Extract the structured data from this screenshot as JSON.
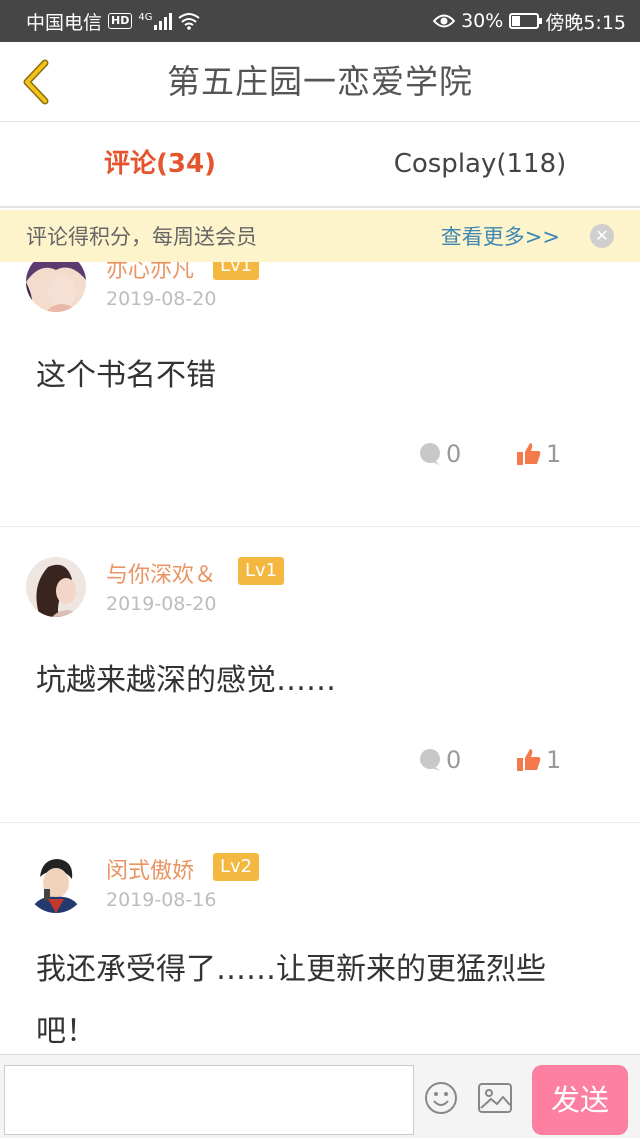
{
  "status_bar": {
    "carrier": "中国电信",
    "hd": "HD",
    "network": "4G",
    "battery_percent": "30%",
    "battery_level": 0.3,
    "time": "傍晚5:15"
  },
  "header": {
    "title": "第五庄园一恋爱学院"
  },
  "tabs": [
    {
      "label": "评论(34)",
      "active": true
    },
    {
      "label": "Cosplay(118)",
      "active": false
    }
  ],
  "banner": {
    "text": "评论得积分，每周送会员",
    "link": "查看更多>>",
    "close_icon": "close-icon"
  },
  "comments": [
    {
      "username": "亦心亦凡",
      "level": "Lv1",
      "date": "2019-08-20",
      "text": "这个书名不错",
      "reply_count": "0",
      "like_count": "1"
    },
    {
      "username": "与你深欢＆",
      "level": "Lv1",
      "date": "2019-08-20",
      "text": "坑越来越深的感觉……",
      "reply_count": "0",
      "like_count": "1"
    },
    {
      "username": "闵式傲娇",
      "level": "Lv2",
      "date": "2019-08-16",
      "text": "我还承受得了……让更新来的更猛烈些吧！",
      "reply_count": "",
      "like_count": ""
    }
  ],
  "bottom_bar": {
    "input_placeholder": "",
    "send_label": "发送"
  },
  "colors": {
    "accent": "#e4542d",
    "username": "#e99463",
    "level_badge": "#f4b840",
    "banner_bg": "#fdf4cc",
    "banner_link": "#3f86b2",
    "send_button": "#fd7fa1",
    "like_icon": "#f47a4d"
  }
}
